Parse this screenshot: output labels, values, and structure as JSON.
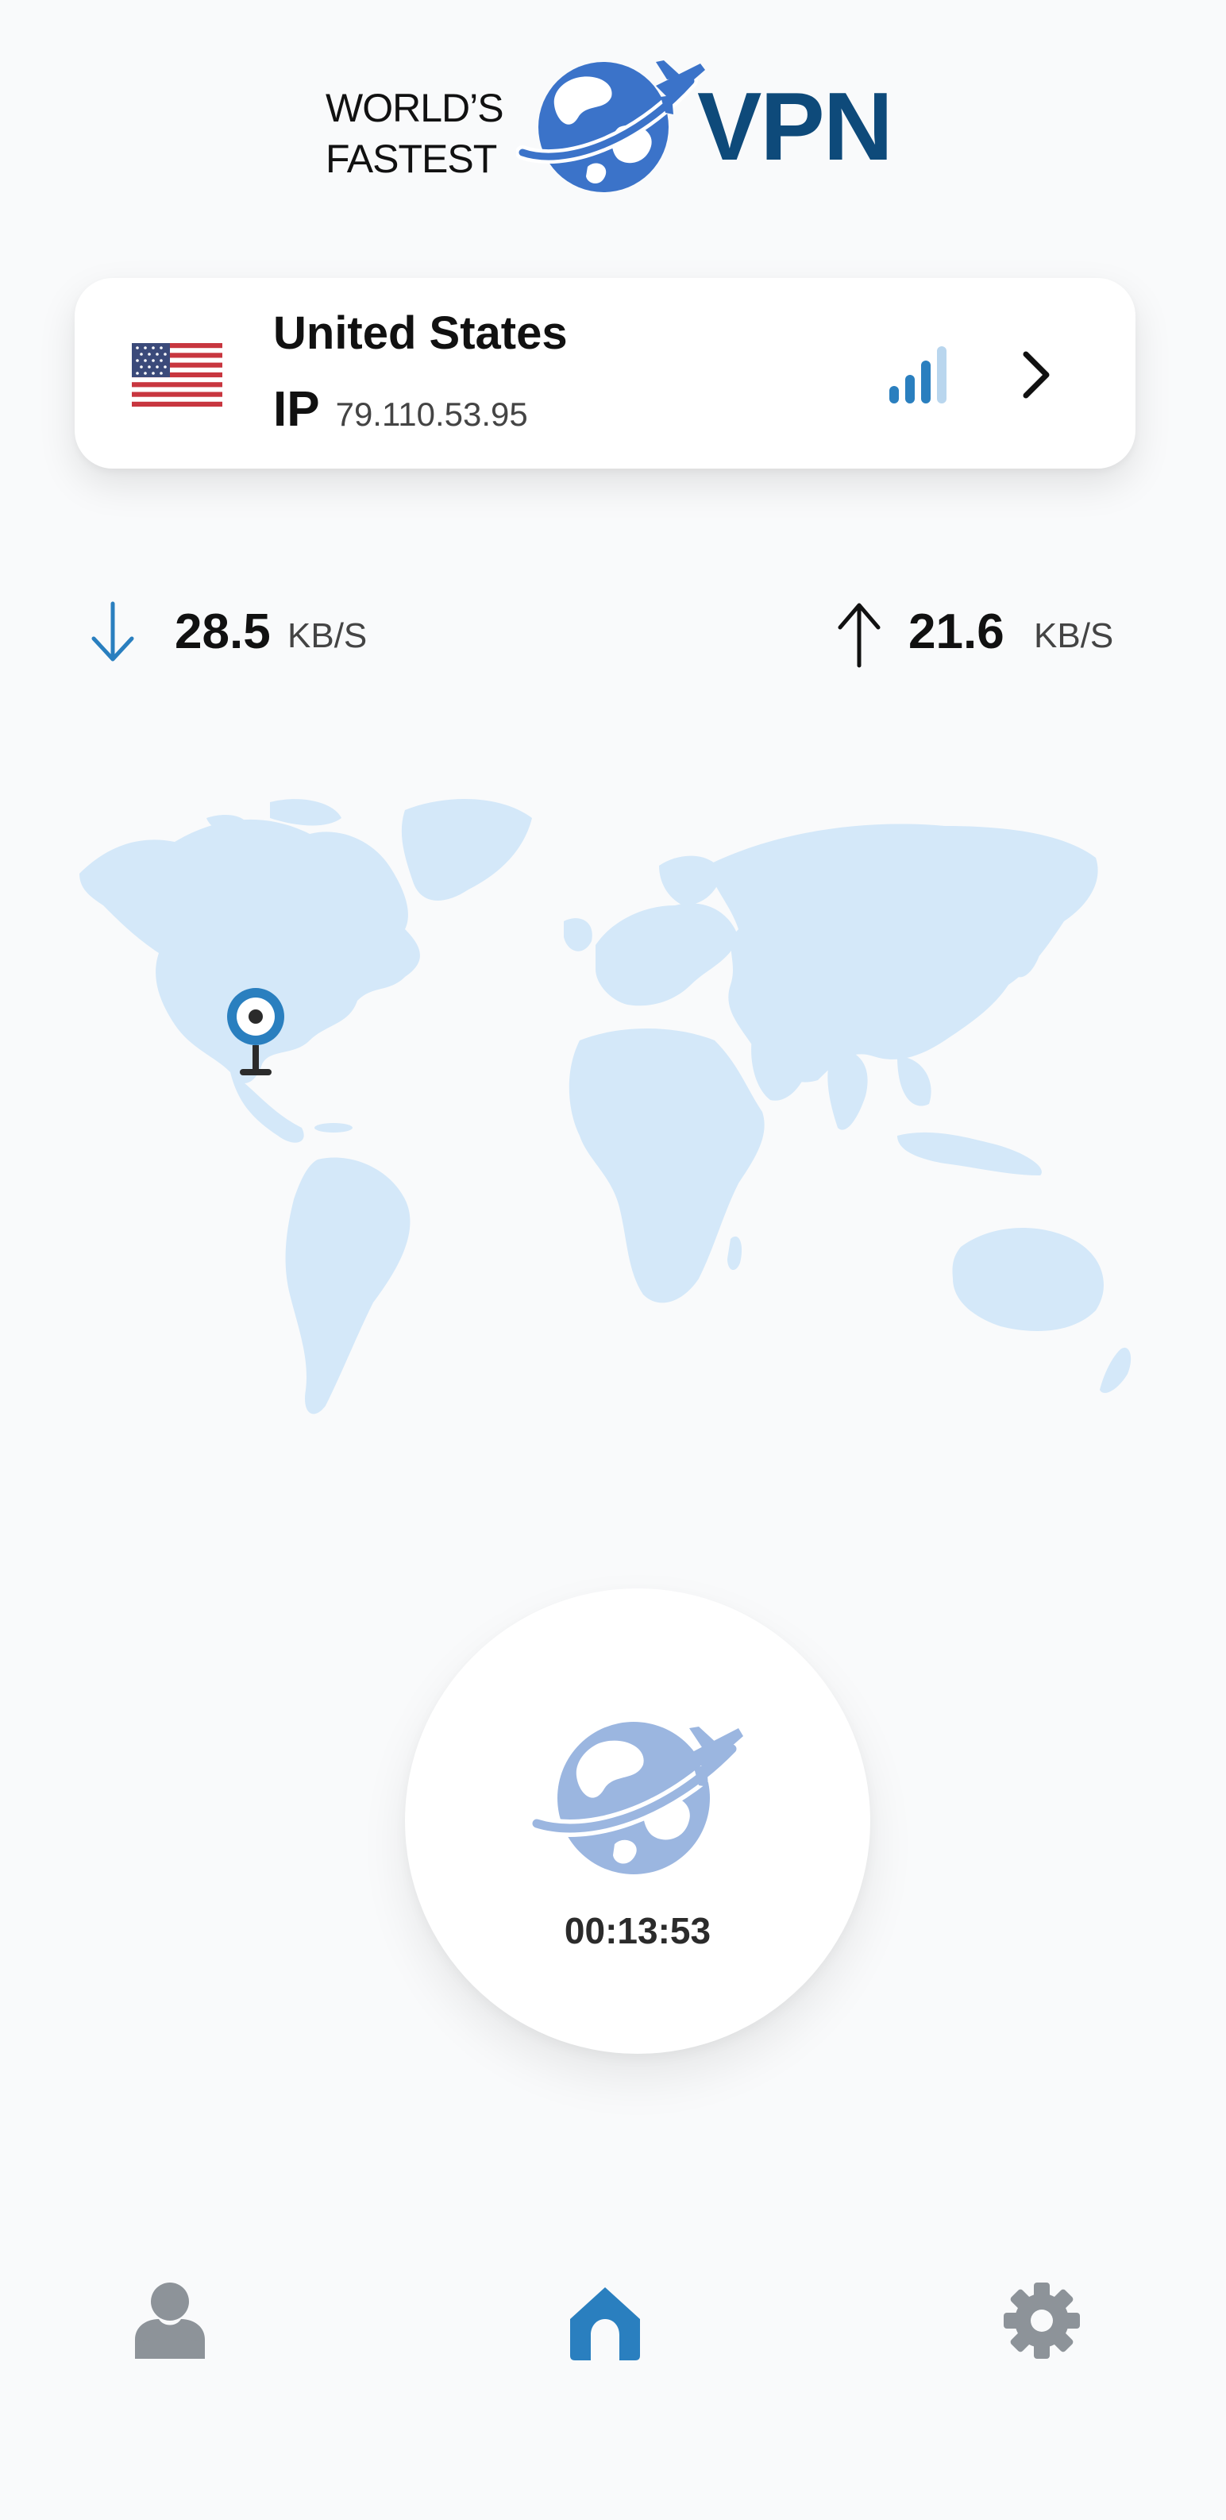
{
  "logo": {
    "tagline_line1": "WORLD’S",
    "tagline_line2": "FASTEST",
    "brand": "VPN"
  },
  "location": {
    "country": "United States",
    "ip_label": "IP",
    "ip_address": "79.110.53.95",
    "flag_icon": "us-flag-icon",
    "signal_icon": "signal-bars-icon",
    "chevron_icon": "chevron-right-icon"
  },
  "speeds": {
    "download": {
      "value": "28.5",
      "unit": "KB/S",
      "icon": "arrow-down-icon"
    },
    "upload": {
      "value": "21.6",
      "unit": "KB/S",
      "icon": "arrow-up-icon"
    }
  },
  "map": {
    "pin_icon": "location-pin-icon"
  },
  "connect": {
    "timer": "00:13:53",
    "icon": "globe-plane-icon"
  },
  "nav": {
    "items": [
      {
        "name": "account",
        "icon": "user-icon",
        "active": false
      },
      {
        "name": "home",
        "icon": "home-icon",
        "active": true
      },
      {
        "name": "settings",
        "icon": "gear-icon",
        "active": false
      }
    ]
  },
  "colors": {
    "brand_dark": "#0e4a7a",
    "brand_blue": "#3b73c9",
    "accent_blue": "#2a7fbf",
    "map_fill": "#d4e8f9",
    "muted_gray": "#8d9399",
    "globe_light": "#9bb6e0"
  }
}
